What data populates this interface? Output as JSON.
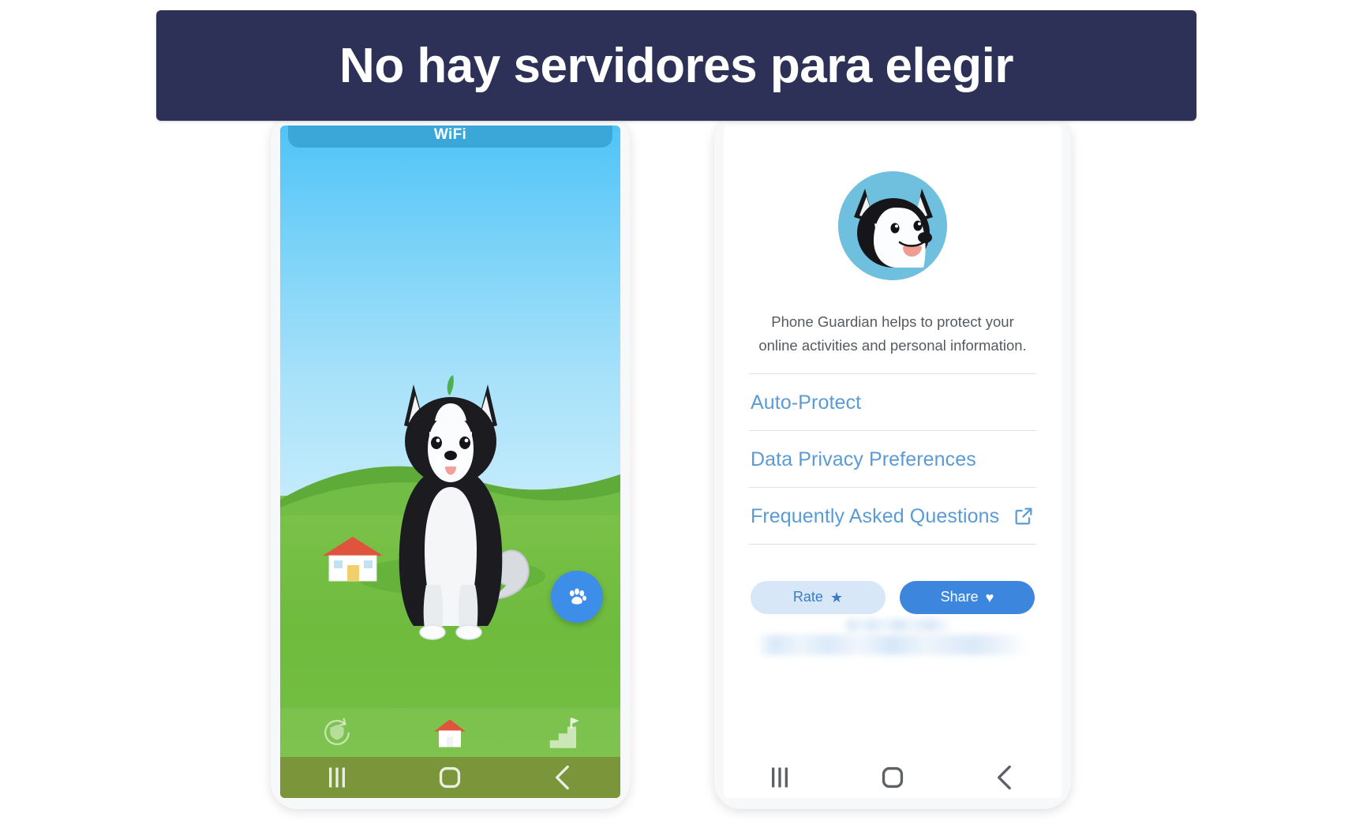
{
  "banner": {
    "text": "No hay servidores para elegir",
    "background_color": "#2e3157",
    "text_color": "#ffffff"
  },
  "left_phone": {
    "name": "vpn-home-screen",
    "status_card": {
      "label": "WiFi",
      "check_icon": "check-icon",
      "chevron_icon": "chevron-down-icon",
      "gear_icon": "gear-icon",
      "card_color": "#3ba7d9",
      "check_color": "#22c03f"
    },
    "fab": {
      "icon": "paw-icon",
      "color": "#3d8ee8"
    },
    "app_nav": [
      {
        "icon": "shield-refresh-icon",
        "name": "nav-protection"
      },
      {
        "icon": "home-icon",
        "name": "nav-home"
      },
      {
        "icon": "flag-steps-icon",
        "name": "nav-progress"
      }
    ],
    "system_nav": [
      {
        "icon": "recents-icon",
        "glyph": "|||"
      },
      {
        "icon": "home-square-icon",
        "glyph": "O"
      },
      {
        "icon": "back-chevron-icon",
        "glyph": "<"
      }
    ]
  },
  "right_phone": {
    "name": "about-screen",
    "avatar": "husky-avatar",
    "description": "Phone Guardian helps to protect your online activities and personal information.",
    "links": [
      {
        "label": "Auto-Protect",
        "external": false
      },
      {
        "label": "Data Privacy Preferences",
        "external": false
      },
      {
        "label": "Frequently Asked Questions",
        "external": true,
        "icon": "external-link-icon"
      }
    ],
    "buttons": [
      {
        "label": "Rate",
        "glyph": "★",
        "style": "secondary",
        "bg": "#d7e7f7",
        "fg": "#3a7dc4"
      },
      {
        "label": "Share",
        "glyph": "♥",
        "style": "primary",
        "bg": "#3d86dd",
        "fg": "#ffffff"
      }
    ],
    "footer_note": "",
    "link_color": "#5b9bd5",
    "system_nav": [
      {
        "icon": "recents-icon",
        "glyph": "|||"
      },
      {
        "icon": "home-square-icon",
        "glyph": "O"
      },
      {
        "icon": "back-chevron-icon",
        "glyph": "<"
      }
    ]
  }
}
